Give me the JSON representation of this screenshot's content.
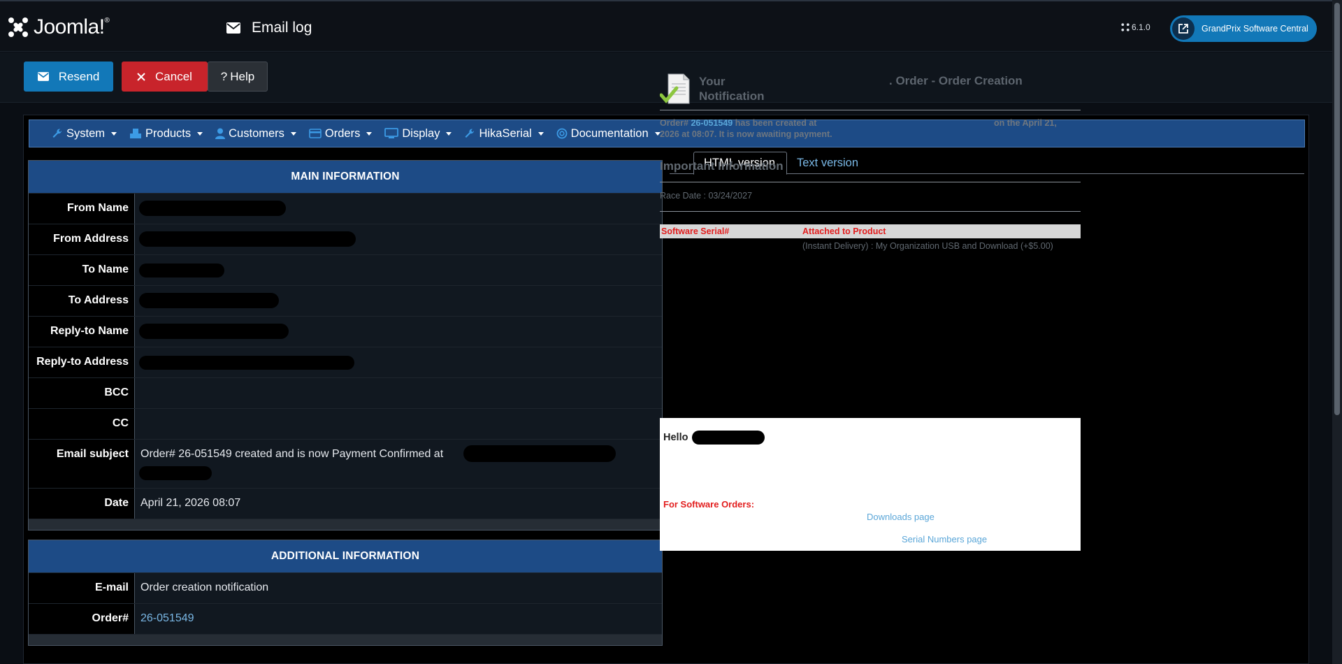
{
  "header": {
    "logo_text": "Joomla!",
    "page_title": "Email log",
    "version": "6.1.0",
    "site_button": "GrandPrix Software Central"
  },
  "toolbar": {
    "resend_label": "Resend",
    "cancel_label": "Cancel",
    "help_label": "Help"
  },
  "menu": {
    "items": [
      "System",
      "Products",
      "Customers",
      "Orders",
      "Display",
      "HikaSerial",
      "Documentation"
    ]
  },
  "main_info": {
    "title": "MAIN INFORMATION",
    "rows": [
      {
        "label": "From Name",
        "value": ""
      },
      {
        "label": "From Address",
        "value": ""
      },
      {
        "label": "To Name",
        "value": ""
      },
      {
        "label": "To Address",
        "value": ""
      },
      {
        "label": "Reply-to Name",
        "value": ""
      },
      {
        "label": "Reply-to Address",
        "value": ""
      },
      {
        "label": "BCC",
        "value": ""
      },
      {
        "label": "CC",
        "value": ""
      },
      {
        "label": "Email subject",
        "value": "Order# 26-051549 created and is now Payment Confirmed at"
      },
      {
        "label": "Date",
        "value": "April 21, 2026 08:07"
      }
    ]
  },
  "additional_info": {
    "title": "ADDITIONAL INFORMATION",
    "rows": [
      {
        "label": "E-mail",
        "value": "Order creation notification"
      },
      {
        "label": "Order#",
        "value": "26-051549"
      }
    ]
  },
  "tabs": {
    "html": "HTML version",
    "text": "Text version"
  },
  "email": {
    "header_left": "Your Notification",
    "header_right": ". Order - Order Creation",
    "msg_prefix": "Order#",
    "order_no": "26-051549",
    "msg_mid": "has been created at",
    "msg_right": "on the April 21,",
    "msg_line2": "2026 at 08:07. It is now awaiting payment.",
    "important": "Important Information",
    "race_date": "Race Date : 03/24/2027",
    "serial_col": "Software Serial#",
    "product_col": "Attached to Product",
    "product_value": "(Instant Delivery) : My Organization USB and Download (+$5.00)",
    "hello": "Hello",
    "software_orders": "For Software Orders:",
    "downloads_link": "Downloads page",
    "serials_link": "Serial Numbers page"
  },
  "colors": {
    "accent_blue": "#1278b8",
    "cancel_red": "#c8242b",
    "panel_header": "#1d4b86",
    "link": "#7ab8e6"
  }
}
